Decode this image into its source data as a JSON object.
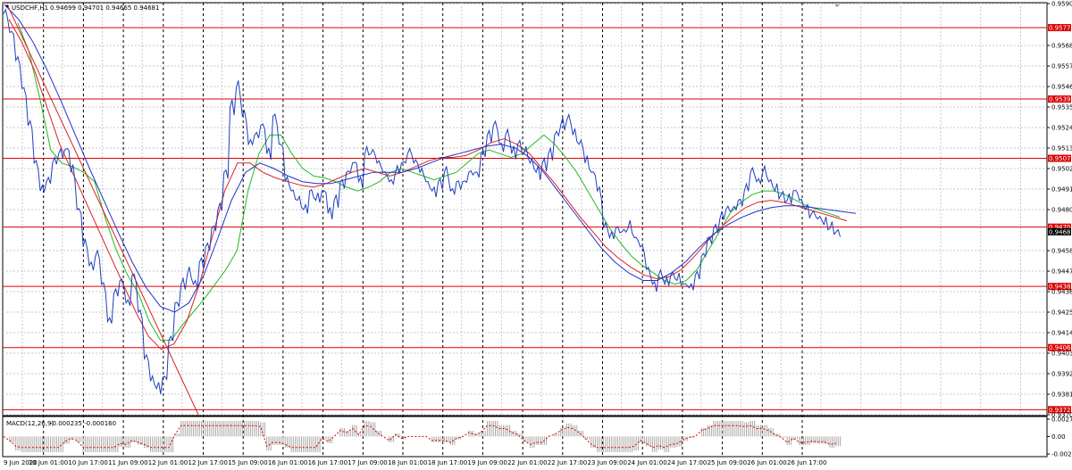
{
  "header": {
    "symbol_timeframe": "USDCHF,H1",
    "ohlc": "0.94699 0.94701 0.94665 0.94681"
  },
  "macd": {
    "label": "MACD(12,26,9)",
    "values": "-0.000235 -0.000160",
    "ticks": [
      "0.002745",
      "0.00",
      "-0.002771"
    ]
  },
  "price_axis": {
    "ticks": [
      "0.95905",
      "0.95680",
      "0.95570",
      "0.95460",
      "0.95350",
      "0.95240",
      "0.95130",
      "0.95020",
      "0.94910",
      "0.94800",
      "0.94580",
      "0.94470",
      "0.94360",
      "0.94250",
      "0.94140",
      "0.94030",
      "0.93920",
      "0.93810",
      "0.93700"
    ]
  },
  "time_axis": {
    "ticks": [
      "9 Jun 2020",
      "10 Jun 01:00",
      "10 Jun 17:00",
      "11 Jun 09:00",
      "12 Jun 01:00",
      "12 Jun 17:00",
      "15 Jun 09:00",
      "16 Jun 01:00",
      "16 Jun 17:00",
      "17 Jun 09:00",
      "18 Jun 01:00",
      "18 Jun 17:00",
      "19 Jun 09:00",
      "22 Jun 01:00",
      "22 Jun 17:00",
      "23 Jun 09:00",
      "24 Jun 01:00",
      "24 Jun 17:00",
      "25 Jun 09:00",
      "26 Jun 01:00",
      "26 Jun 17:00"
    ]
  },
  "colors": {
    "price": "#1f3fbf",
    "ma_fast": "#22bb22",
    "ma_mid": "#dd2222",
    "ma_slow": "#2233cc",
    "level": "#dd0000",
    "macd_hist": "#a8a8a8",
    "macd_signal": "#dd0000"
  },
  "chart_data": {
    "type": "line",
    "symbol": "USDCHF",
    "timeframe": "H1",
    "price_range": [
      0.937,
      0.95905
    ],
    "x_labels": [
      "9 Jun 2020",
      "10 Jun 01:00",
      "10 Jun 17:00",
      "11 Jun 09:00",
      "12 Jun 01:00",
      "12 Jun 17:00",
      "15 Jun 09:00",
      "16 Jun 01:00",
      "16 Jun 17:00",
      "17 Jun 09:00",
      "18 Jun 01:00",
      "18 Jun 17:00",
      "19 Jun 09:00",
      "22 Jun 01:00",
      "22 Jun 17:00",
      "23 Jun 09:00",
      "24 Jun 01:00",
      "24 Jun 17:00",
      "25 Jun 09:00",
      "26 Jun 01:00",
      "26 Jun 17:00"
    ],
    "levels": [
      {
        "value": 0.95776,
        "label": "0.95776"
      },
      {
        "value": 0.95393,
        "label": "0.95393"
      },
      {
        "value": 0.95075,
        "label": "0.95075"
      },
      {
        "value": 0.94706,
        "label": "0.94706"
      },
      {
        "value": 0.94388,
        "label": "0.94388"
      },
      {
        "value": 0.9406,
        "label": "0.94060"
      },
      {
        "value": 0.93727,
        "label": "0.93727"
      }
    ],
    "current_price": {
      "value": 0.94681,
      "label": "0.94681"
    },
    "series": [
      {
        "values": [
          0.9585,
          0.9575,
          0.956,
          0.9545,
          0.9525,
          0.9505,
          0.949,
          0.9495,
          0.9505,
          0.951,
          0.9512,
          0.95,
          0.948,
          0.946,
          0.945,
          0.9455,
          0.944,
          0.942,
          0.9435,
          0.9442,
          0.943,
          0.9445,
          0.9425,
          0.94,
          0.9388,
          0.9384,
          0.939,
          0.941,
          0.943,
          0.944,
          0.9445,
          0.944,
          0.9452,
          0.946,
          0.947,
          0.948,
          0.95,
          0.9535,
          0.9545,
          0.953,
          0.9515,
          0.952,
          0.9525,
          0.951,
          0.953,
          0.9515,
          0.9495,
          0.949,
          0.9485,
          0.948,
          0.949,
          0.9485,
          0.949,
          0.9478,
          0.9485,
          0.9495,
          0.95,
          0.9505,
          0.9495,
          0.951,
          0.951,
          0.9505,
          0.95,
          0.9495,
          0.95,
          0.9505,
          0.951,
          0.9505,
          0.95,
          0.9495,
          0.949,
          0.9495,
          0.95,
          0.949,
          0.9495,
          0.9495,
          0.95,
          0.95,
          0.951,
          0.952,
          0.9525,
          0.9515,
          0.952,
          0.951,
          0.9515,
          0.951,
          0.9505,
          0.95,
          0.9505,
          0.951,
          0.952,
          0.9525,
          0.9528,
          0.952,
          0.9515,
          0.9505,
          0.95,
          0.949,
          0.947,
          0.9465,
          0.947,
          0.9468,
          0.947,
          0.9465,
          0.946,
          0.9448,
          0.944,
          0.9445,
          0.944,
          0.9445,
          0.9442,
          0.944,
          0.9438,
          0.9445,
          0.9455,
          0.9465,
          0.947,
          0.9475,
          0.948,
          0.948,
          0.9485,
          0.949,
          0.95,
          0.9495,
          0.95,
          0.9495,
          0.949,
          0.9488,
          0.9485,
          0.949,
          0.9485,
          0.948,
          0.9478,
          0.9475,
          0.9472,
          0.947,
          0.9468
        ]
      },
      {
        "values": [
          0.958,
          0.9565,
          0.954,
          0.9512,
          0.9505,
          0.9503,
          0.95,
          0.9495,
          0.9475,
          0.9458,
          0.9445,
          0.9435,
          0.942,
          0.941,
          0.941,
          0.9418,
          0.9425,
          0.9432,
          0.944,
          0.9448,
          0.9458,
          0.949,
          0.951,
          0.952,
          0.952,
          0.951,
          0.9502,
          0.9498,
          0.9497,
          0.9495,
          0.9492,
          0.949,
          0.9492,
          0.9495,
          0.95,
          0.9502,
          0.95,
          0.9498,
          0.9496,
          0.9498,
          0.95,
          0.9505,
          0.951,
          0.9512,
          0.951,
          0.9508,
          0.951,
          0.9515,
          0.952,
          0.9515,
          0.9508,
          0.95,
          0.949,
          0.948,
          0.947,
          0.9462,
          0.9455,
          0.945,
          0.9446,
          0.9442,
          0.944,
          0.9442,
          0.9448,
          0.9458,
          0.9468,
          0.9478,
          0.9484,
          0.9488,
          0.949,
          0.949,
          0.9488,
          0.9485,
          0.9482,
          0.948,
          0.9478,
          0.9476
        ]
      },
      {
        "values": [
          0.9582,
          0.957,
          0.9555,
          0.9535,
          0.9515,
          0.95,
          0.9485,
          0.947,
          0.9455,
          0.944,
          0.9425,
          0.9412,
          0.9405,
          0.9408,
          0.942,
          0.944,
          0.9465,
          0.949,
          0.9505,
          0.9505,
          0.95,
          0.9497,
          0.9495,
          0.9493,
          0.9492,
          0.9494,
          0.9497,
          0.95,
          0.9502,
          0.95,
          0.9498,
          0.95,
          0.9503,
          0.9506,
          0.9508,
          0.9508,
          0.9509,
          0.9512,
          0.9516,
          0.9518,
          0.9515,
          0.951,
          0.9502,
          0.9494,
          0.9485,
          0.9476,
          0.9468,
          0.946,
          0.9454,
          0.9449,
          0.9445,
          0.9443,
          0.9444,
          0.9448,
          0.9455,
          0.9463,
          0.947,
          0.9476,
          0.9481,
          0.9484,
          0.9485,
          0.9484,
          0.9482,
          0.948,
          0.9478,
          0.9476,
          0.9474
        ]
      },
      {
        "values": [
          0.959,
          0.9582,
          0.957,
          0.9555,
          0.9538,
          0.952,
          0.9502,
          0.9485,
          0.9468,
          0.9452,
          0.9438,
          0.9428,
          0.9425,
          0.943,
          0.9444,
          0.9464,
          0.9485,
          0.95,
          0.9505,
          0.9502,
          0.9498,
          0.9495,
          0.9494,
          0.9494,
          0.9496,
          0.9498,
          0.95,
          0.95,
          0.95,
          0.9502,
          0.9505,
          0.9508,
          0.951,
          0.9512,
          0.9514,
          0.9515,
          0.9513,
          0.9508,
          0.95,
          0.949,
          0.948,
          0.947,
          0.946,
          0.9452,
          0.9446,
          0.9442,
          0.9442,
          0.9446,
          0.9452,
          0.946,
          0.9467,
          0.9472,
          0.9476,
          0.9479,
          0.9481,
          0.9482,
          0.9482,
          0.9481,
          0.948,
          0.9479,
          0.9478
        ]
      }
    ],
    "macd_range": [
      -0.002771,
      0.002745
    ]
  }
}
